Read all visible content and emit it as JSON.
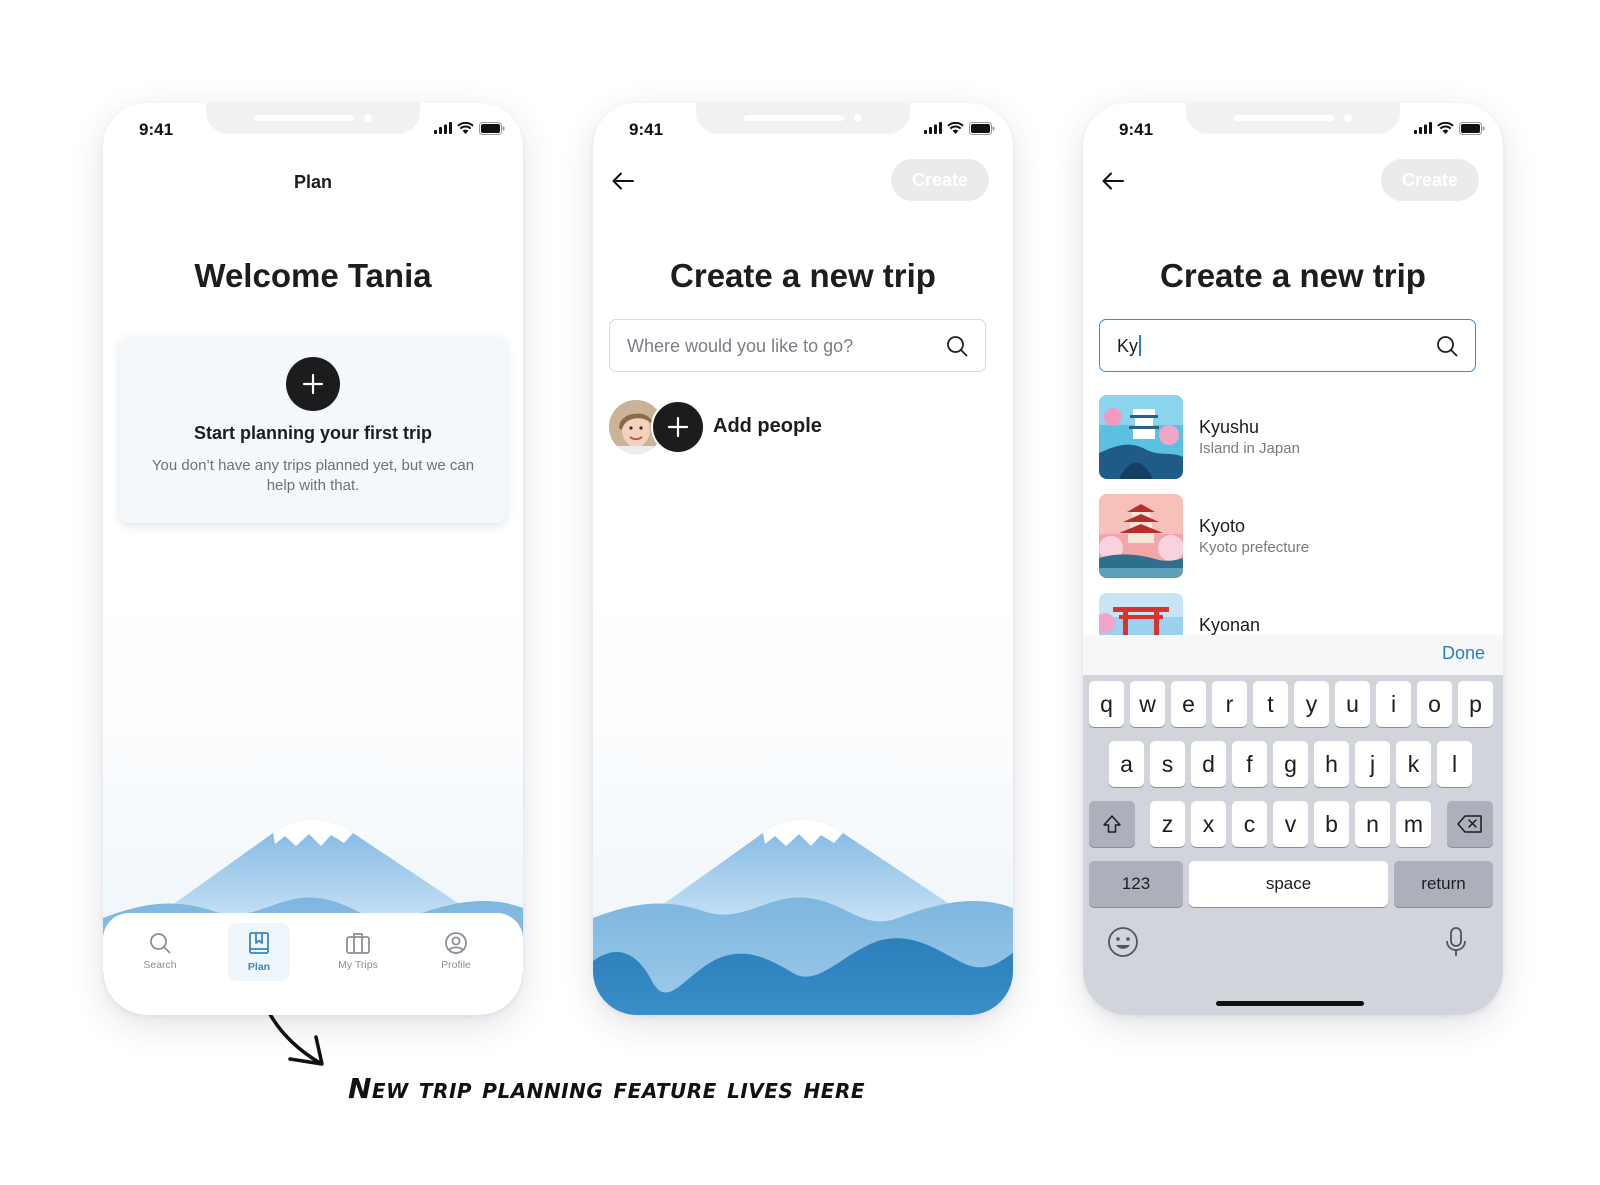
{
  "status_time": "9:41",
  "screen_plan": {
    "nav_title": "Plan",
    "heading": "Welcome Tania",
    "card": {
      "title": "Start planning your first trip",
      "description": "You don’t have any trips planned yet, but we can help with that."
    },
    "tabs": [
      {
        "label": "Search",
        "icon": "search-icon",
        "active": false
      },
      {
        "label": "Plan",
        "icon": "book-icon",
        "active": true
      },
      {
        "label": "My Trips",
        "icon": "suitcase-icon",
        "active": false
      },
      {
        "label": "Profile",
        "icon": "profile-icon",
        "active": false
      }
    ]
  },
  "screen_create": {
    "create_label": "Create",
    "heading": "Create a new trip",
    "search_placeholder": "Where would you like to go?",
    "add_people_label": "Add people"
  },
  "screen_search": {
    "create_label": "Create",
    "heading": "Create a new trip",
    "search_value": "Ky",
    "results": [
      {
        "name": "Kyushu",
        "subtitle": "Island in Japan"
      },
      {
        "name": "Kyoto",
        "subtitle": "Kyoto prefecture"
      },
      {
        "name": "Kyonan",
        "subtitle": ""
      }
    ],
    "done_label": "Done",
    "keyboard": {
      "row1": [
        "q",
        "w",
        "e",
        "r",
        "t",
        "y",
        "u",
        "i",
        "o",
        "p"
      ],
      "row2": [
        "a",
        "s",
        "d",
        "f",
        "g",
        "h",
        "j",
        "k",
        "l"
      ],
      "row3": [
        "z",
        "x",
        "c",
        "v",
        "b",
        "n",
        "m"
      ],
      "numbers_label": "123",
      "space_label": "space",
      "return_label": "return"
    }
  },
  "annotation": "New trip planning feature lives here",
  "colors": {
    "accent_blue": "#2a7fc0",
    "dark_button": "#1c1c1e",
    "disabled_button": "#ebebeb",
    "mountain_deep": "#2e82bc",
    "mountain_light": "#b9dcf2"
  }
}
